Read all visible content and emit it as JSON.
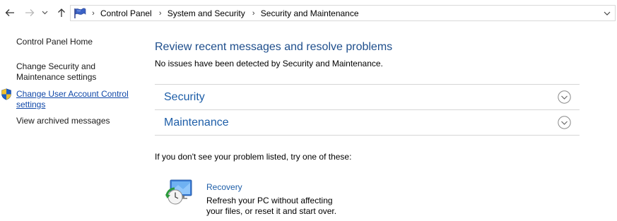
{
  "nav": {
    "back_icon": "arrow-left-icon",
    "forward_icon": "arrow-right-icon",
    "recent_icon": "chevron-down-icon",
    "up_icon": "arrow-up-icon"
  },
  "address": {
    "icon": "control-panel-flag-icon",
    "breadcrumbs": [
      "Control Panel",
      "System and Security",
      "Security and Maintenance"
    ],
    "dropdown_icon": "chevron-down-icon"
  },
  "left_pane": {
    "home": "Control Panel Home",
    "change_settings_line1": "Change Security and",
    "change_settings_line2": "Maintenance settings",
    "uac_line1": "Change User Account Control",
    "uac_line2": "settings",
    "uac_icon": "uac-shield-icon",
    "archived": "View archived messages"
  },
  "main": {
    "title": "Review recent messages and resolve problems",
    "subtitle": "No issues have been detected by Security and Maintenance.",
    "sections": [
      {
        "label": "Security",
        "expand_icon": "chevron-circle-down-icon"
      },
      {
        "label": "Maintenance",
        "expand_icon": "chevron-circle-down-icon"
      }
    ],
    "try_text": "If you don't see your problem listed, try one of these:",
    "recovery": {
      "title": "Recovery",
      "desc_line1": "Refresh your PC without affecting",
      "desc_line2": "your files, or reset it and start over.",
      "icon": "recovery-icon"
    }
  },
  "colors": {
    "link_blue": "#1e5ea8",
    "heading_blue": "#1e4e8c",
    "divider": "#d6d6d6"
  }
}
